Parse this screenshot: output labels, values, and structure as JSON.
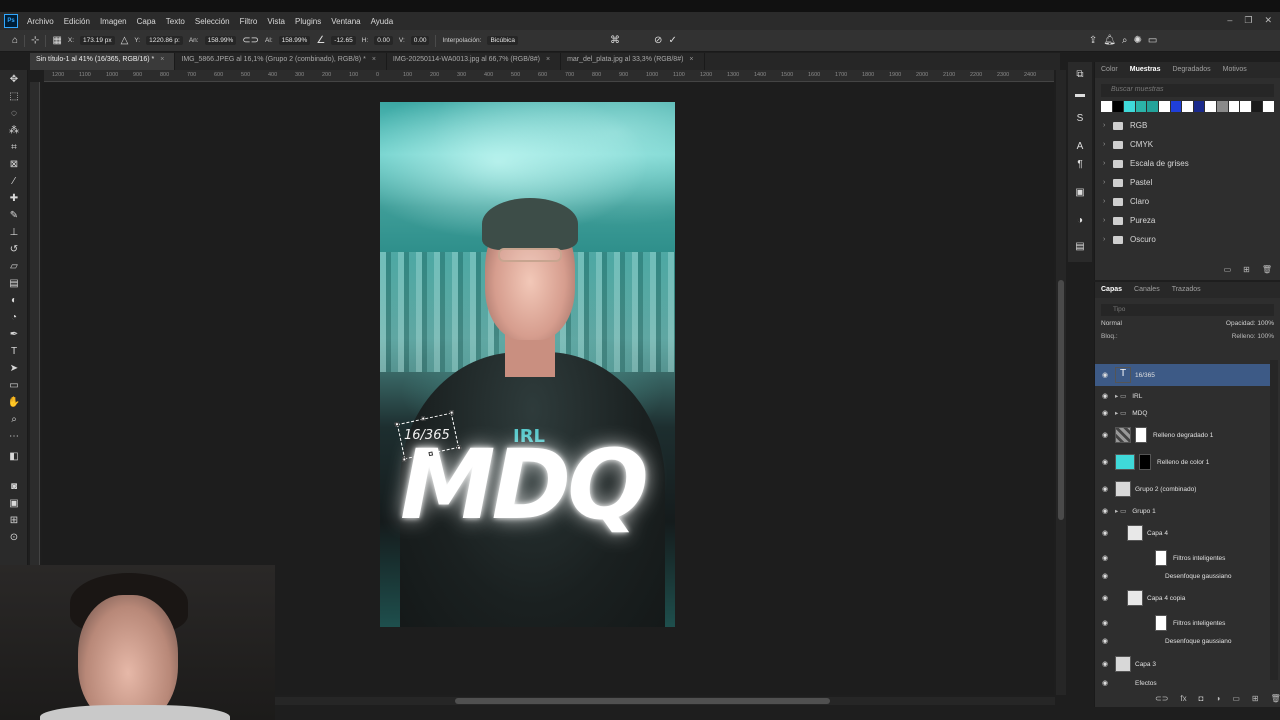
{
  "app": {
    "logo": "Ps"
  },
  "menu": [
    "Archivo",
    "Edición",
    "Imagen",
    "Capa",
    "Texto",
    "Selección",
    "Filtro",
    "Vista",
    "Plugins",
    "Ventana",
    "Ayuda"
  ],
  "window_controls": [
    "–",
    "❐",
    "✕"
  ],
  "options": {
    "x_label": "X:",
    "x_value": "173.19 px",
    "y_label": "Y:",
    "y_value": "1220.86 p:",
    "w_label": "An:",
    "w_value": "158.99%",
    "h_label": "Al:",
    "h_value": "158.99%",
    "angle_value": "-12.65",
    "hskew_label": "H:",
    "hskew_value": "0.00",
    "vskew_label": "V:",
    "vskew_value": "0.00",
    "interp_label": "Interpolación:",
    "interp_value": "Bicúbica"
  },
  "tabs": [
    {
      "label": "Sin título-1 al 41% (16/365, RGB/16) *"
    },
    {
      "label": "IMG_5866.JPEG al 16,1% (Grupo 2 (combinado), RGB/8) *"
    },
    {
      "label": "IMG-20250114-WA0013.jpg al 66,7% (RGB/8#)"
    },
    {
      "label": "mar_del_plata.jpg al 33,3% (RGB/8#)"
    }
  ],
  "ruler_ticks": [
    "1200",
    "1100",
    "1000",
    "900",
    "800",
    "700",
    "600",
    "500",
    "400",
    "300",
    "200",
    "100",
    "0",
    "100",
    "200",
    "300",
    "400",
    "500",
    "600",
    "700",
    "800",
    "900",
    "1000",
    "1100",
    "1200",
    "1300",
    "1400",
    "1500",
    "1600",
    "1700",
    "1800",
    "1900",
    "2000",
    "2100",
    "2200",
    "2300",
    "2400"
  ],
  "artwork": {
    "small_text": "16/365",
    "irl": "IRL",
    "title": "MDQ"
  },
  "swatches_panel": {
    "tabs": [
      "Color",
      "Muestras",
      "Degradados",
      "Motivos"
    ],
    "search_placeholder": "Buscar muestras",
    "colors": [
      "#ffffff",
      "#000000",
      "#3fd9d9",
      "#2bb3a8",
      "#23a39a",
      "#ffffff",
      "#1f3fd9",
      "#ffffff",
      "#1b2a8c",
      "#ffffff",
      "#8a8a8a",
      "#ffffff",
      "#ffffff",
      "#1a1a1a",
      "#ffffff"
    ],
    "folders": [
      "RGB",
      "CMYK",
      "Escala de grises",
      "Pastel",
      "Claro",
      "Pureza",
      "Oscuro"
    ]
  },
  "layers_panel": {
    "tabs": [
      "Capas",
      "Canales",
      "Trazados"
    ],
    "filter_placeholder": "Tipo",
    "blend_mode": "Normal",
    "opacity_label": "Opacidad:",
    "opacity_value": "100%",
    "lock_label": "Bloq.:",
    "fill_label": "Relleno:",
    "fill_value": "100%",
    "layers": [
      {
        "name": "16/365",
        "kind": "text",
        "selected": true
      },
      {
        "name": "IRL",
        "kind": "group"
      },
      {
        "name": "MDQ",
        "kind": "group"
      },
      {
        "name": "Relleno degradado 1",
        "kind": "gradient"
      },
      {
        "name": "Relleno de color 1",
        "kind": "color"
      },
      {
        "name": "Grupo 2 (combinado)",
        "kind": "image"
      },
      {
        "name": "Grupo 1",
        "kind": "group"
      },
      {
        "name": "Capa 4",
        "kind": "smart"
      },
      {
        "name": "Filtros inteligentes",
        "kind": "filter"
      },
      {
        "name": "Desenfoque gaussiano",
        "kind": "effect"
      },
      {
        "name": "Capa 4 copia",
        "kind": "smart"
      },
      {
        "name": "Filtros inteligentes",
        "kind": "filter"
      },
      {
        "name": "Desenfoque gaussiano",
        "kind": "effect"
      },
      {
        "name": "Capa 3",
        "kind": "image"
      },
      {
        "name": "Efectos",
        "kind": "effect"
      }
    ]
  }
}
